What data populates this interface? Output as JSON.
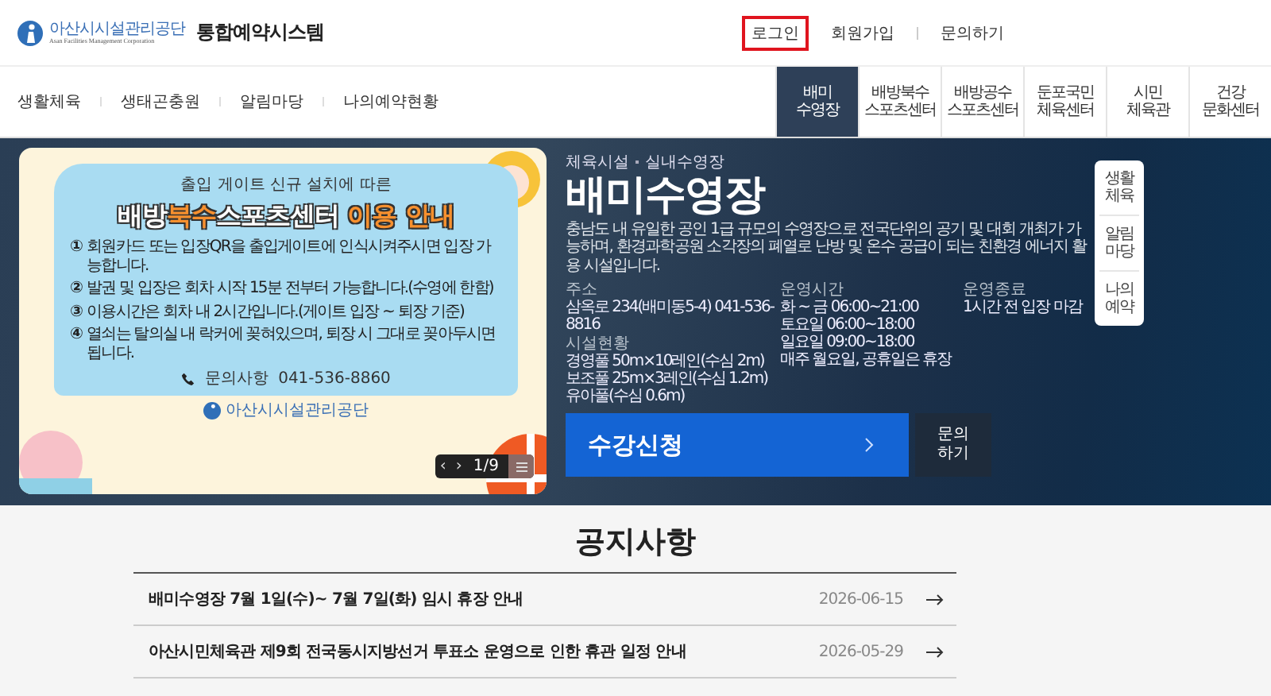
{
  "header": {
    "logo": {
      "name": "아산시시설관리공단",
      "subtitle": "Asan Facilities Management Corporation"
    },
    "title": "통합예약시스템",
    "links": [
      {
        "label": "로그인",
        "highlighted": true
      },
      {
        "label": "회원가입",
        "highlighted": false
      },
      {
        "label": "문의하기",
        "highlighted": false
      }
    ]
  },
  "nav": {
    "items": [
      "생활체육",
      "생태곤충원",
      "알림마당",
      "나의예약현황"
    ],
    "facility_tabs": [
      {
        "lines": [
          "배미",
          "수영장"
        ],
        "selected": true
      },
      {
        "lines": [
          "배방북수",
          "스포츠센터"
        ],
        "selected": false
      },
      {
        "lines": [
          "배방공수",
          "스포츠센터"
        ],
        "selected": false
      },
      {
        "lines": [
          "둔포국민",
          "체육센터"
        ],
        "selected": false
      },
      {
        "lines": [
          "시민",
          "체육관"
        ],
        "selected": false
      },
      {
        "lines": [
          "건강",
          "문화센터"
        ],
        "selected": false
      }
    ]
  },
  "slider": {
    "poster": {
      "subtitle": "출입 게이트 신규 설치에 따른",
      "title_parts": [
        {
          "text": "배방",
          "accent": false
        },
        {
          "text": "북수",
          "accent": true
        },
        {
          "text": "스포츠센터",
          "accent": false
        },
        {
          "text": " 이용 안내",
          "accent": true
        }
      ],
      "items": [
        {
          "number": "①",
          "text": "회원카드 또는 입장QR을 출입게이트에 인식시켜주시면 입장 가능합니다."
        },
        {
          "number": "②",
          "text": "발권 및 입장은 회차 시작 15분 전부터 가능합니다.(수영에 한함)"
        },
        {
          "number": "③",
          "text": "이용시간은 회차 내 2시간입니다.(게이트 입장 ~ 퇴장 기준)"
        },
        {
          "number": "④",
          "text": "열쇠는 탈의실 내 락커에 꽂혀있으며, 퇴장 시 그대로 꽂아두시면 됩니다."
        }
      ],
      "contact_label": "문의사항",
      "contact_phone": "041-536-8860",
      "logo_name": "아산시시설관리공단"
    },
    "prev": "‹",
    "next": "›",
    "counter": "1/9"
  },
  "facility": {
    "breadcrumb": [
      "체육시설",
      "실내수영장"
    ],
    "name": "배미수영장",
    "description": "충남도 내 유일한 공인 1급 규모의 수영장으로 전국단위의 공기 및 대회 개최가 가능하며, 환경과학공원 소각장의 폐열로 난방 및 온수 공급이 되는 친환경 에너지 활용 시설입니다.",
    "info_columns": [
      [
        {
          "label": "주소",
          "lines": [
            "삼옥로 234(배미동5-4) 041-536-8816"
          ]
        },
        {
          "label": "시설현황",
          "lines": [
            "경영풀 50m×10레인(수심 2m)",
            "보조풀 25m×3레인(수심 1.2m)",
            "유아풀(수심 0.6m)"
          ]
        }
      ],
      [
        {
          "label": "운영시간",
          "lines": [
            "화 ~ 금 06:00~21:00",
            "토요일 06:00~18:00",
            "일요일 09:00~18:00",
            "매주 월요일, 공휴일은 휴장"
          ]
        }
      ],
      [
        {
          "label": "운영종료",
          "lines": [
            "1시간 전 입장 마감"
          ]
        }
      ]
    ],
    "apply_button": "수강신청",
    "inquiry_lines": [
      "문의",
      "하기"
    ]
  },
  "quick_menu": [
    {
      "lines": [
        "생활",
        "체육"
      ]
    },
    {
      "lines": [
        "알림",
        "마당"
      ]
    },
    {
      "lines": [
        "나의",
        "예약"
      ]
    }
  ],
  "notices": {
    "title": "공지사항",
    "items": [
      {
        "title": "배미수영장 7월 1일(수)~ 7월 7일(화) 임시 휴장 안내",
        "date": "2026-06-15"
      },
      {
        "title": "아산시민체육관 제9회 전국동시지방선거 투표소 운영으로 인한 휴관 일정 안내",
        "date": "2026-05-29"
      }
    ]
  }
}
